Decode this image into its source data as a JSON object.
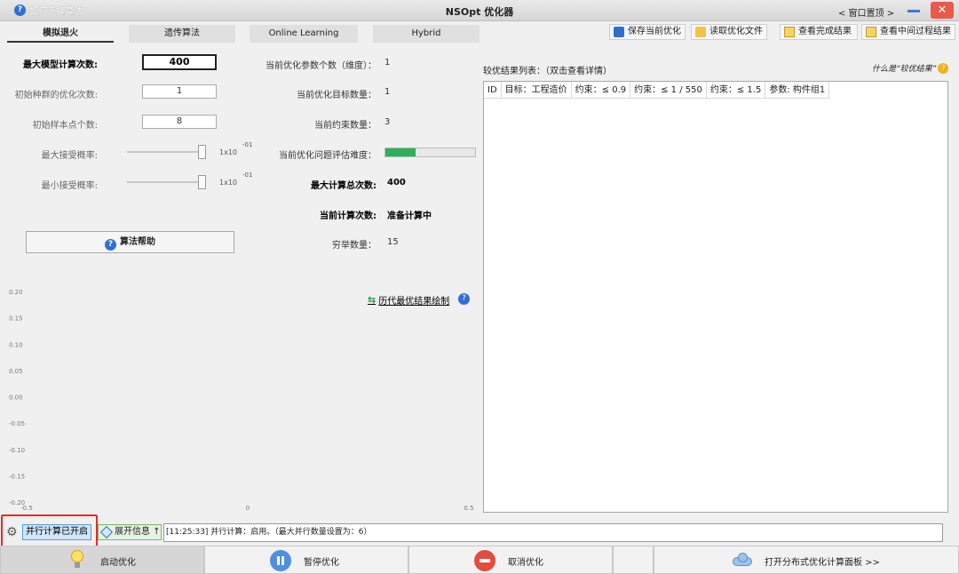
{
  "window": {
    "help_link": "如何选择算法",
    "title": "NSOpt 优化器",
    "pin_toggle": "< 窗口置顶 >"
  },
  "tabs": [
    {
      "label": "模拟退火",
      "active": true
    },
    {
      "label": "遗传算法",
      "active": false
    },
    {
      "label": "Online Learning",
      "active": false
    },
    {
      "label": "Hybrid",
      "active": false
    }
  ],
  "toolbar": {
    "save": "保存当前优化",
    "load": "读取优化文件",
    "view_done": "查看完成结果",
    "view_mid": "查看中间过程结果"
  },
  "params": {
    "max_model_calc": {
      "label": "最大模型计算次数:",
      "value": "400"
    },
    "init_pop_iter": {
      "label": "初始种群的优化次数:",
      "value": "1"
    },
    "init_samples": {
      "label": "初始样本点个数:",
      "value": "8"
    },
    "max_accept": {
      "label": "最大接受概率:",
      "unit": "1x10",
      "exp": "-01"
    },
    "min_accept": {
      "label": "最小接受概率:",
      "unit": "1x10",
      "exp": "-01"
    },
    "algo_help": "算法帮助"
  },
  "info": {
    "param_count": {
      "label": "当前优化参数个数（维度）：",
      "value": "1"
    },
    "target_count": {
      "label": "当前优化目标数量：",
      "value": "1"
    },
    "constraint_count": {
      "label": "当前约束数量：",
      "value": "3"
    },
    "difficulty": {
      "label": "当前优化问题评估难度：",
      "level": 0.34
    },
    "max_total": {
      "label": "最大计算总次数:",
      "value": "400"
    },
    "current_count": {
      "label": "当前计算次数:",
      "value": "准备计算中"
    },
    "enum_count": {
      "label": "穷举数量：",
      "value": "15"
    },
    "history_link": "历代最优结果绘制"
  },
  "chart_data": {
    "type": "line",
    "x_ticks": [
      "-0.5",
      "0",
      "0.5"
    ],
    "y_ticks": [
      "0.20",
      "0.15",
      "0.10",
      "0.05",
      "0.00",
      "-0.05",
      "-0.10",
      "-0.15",
      "-0.20"
    ],
    "xlim": [
      -0.5,
      0.5
    ],
    "ylim": [
      -0.2,
      0.2
    ],
    "series": []
  },
  "results": {
    "title": "较优结果列表：（双击查看详情）",
    "what_is": "什么是“较优结果”",
    "columns": [
      "ID",
      "目标：工程造价",
      "约束：≤ 0.9",
      "约束：≤ 1 / 550",
      "约束：≤ 1.5",
      "参数: 构件组1"
    ]
  },
  "status": {
    "parallel_btn": "并行计算已开启",
    "expand_btn": "展开信息 ↑",
    "log": "[11:25:33] 并行计算：启用。（最大并行数量设置为：6）"
  },
  "bottom": {
    "start": "启动优化",
    "pause": "暂停优化",
    "cancel": "取消优化",
    "distributed": "打开分布式优化计算面板 >>"
  }
}
